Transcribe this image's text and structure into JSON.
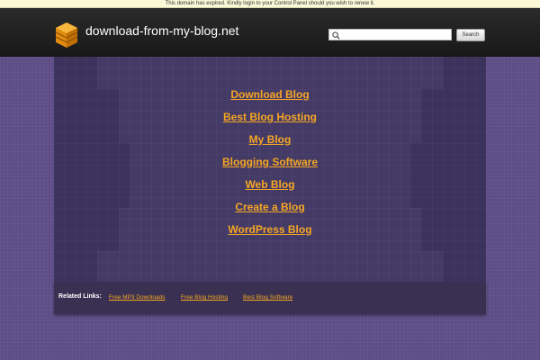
{
  "notice": {
    "text": "This domain has expired. Kindly login to your Control Panel should you wish to renew it."
  },
  "header": {
    "site_name": "download-from-my-blog.net",
    "logo_icon": "stacked-cubes-icon",
    "search": {
      "placeholder": "",
      "value": "",
      "button_label": "Search"
    }
  },
  "main": {
    "links": [
      "Download Blog",
      "Best Blog Hosting",
      "My Blog",
      "Blogging Software",
      "Web Blog",
      "Create a Blog",
      "WordPress Blog"
    ]
  },
  "related": {
    "title": "Related Links:",
    "links": [
      "Free MP3 Downloads",
      "Free Blog Hosting",
      "Best Blog Software"
    ]
  },
  "colors": {
    "link": "#f5a623",
    "background": "#5e4d86",
    "panel": "#443a66",
    "header": "#1e1e1e"
  }
}
